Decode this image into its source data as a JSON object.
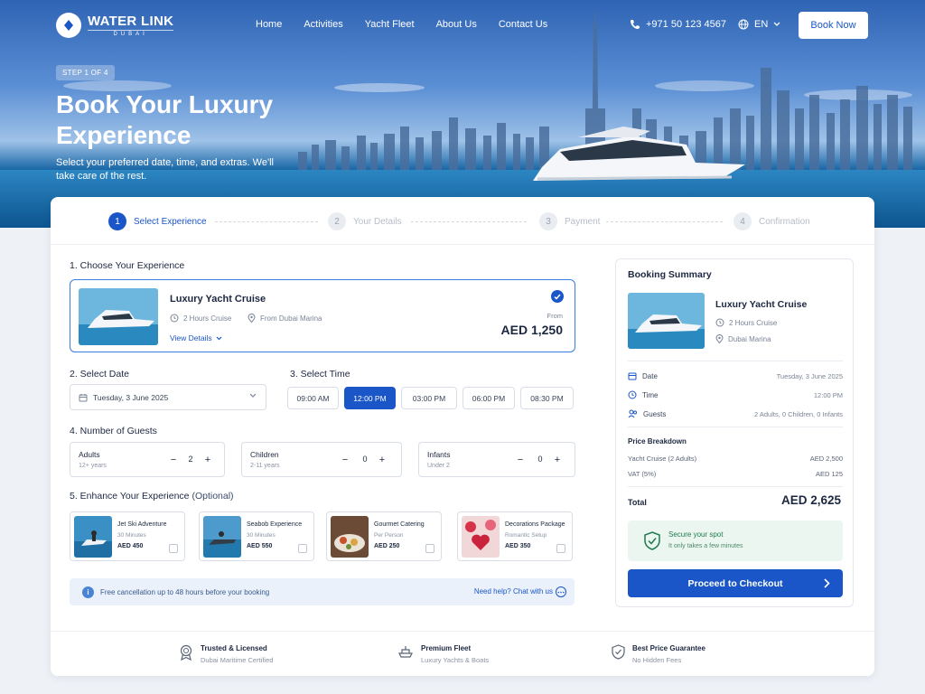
{
  "brand": {
    "name": "WATER LINK",
    "sub": "DUBAI"
  },
  "nav": {
    "links": [
      "Home",
      "Activities",
      "Yacht Fleet",
      "About Us",
      "Contact Us"
    ],
    "phone": "+971 50 123 4567",
    "lang": "EN",
    "book_now": "Book Now"
  },
  "hero": {
    "step": "STEP 1 OF 4",
    "title": "Book Your Luxury Experience",
    "subtitle": "Select your preferred date, time, and extras. We'll take care of the rest."
  },
  "stepper": [
    {
      "num": "1",
      "label": "Select Experience"
    },
    {
      "num": "2",
      "label": "Your Details"
    },
    {
      "num": "3",
      "label": "Payment"
    },
    {
      "num": "4",
      "label": "Confirmation"
    }
  ],
  "sections": {
    "choose": "1. Choose Your Experience",
    "date": "2. Select Date",
    "time": "3. Select Time",
    "guests": "4. Number of Guests",
    "enhance": "5. Enhance Your Experience",
    "enhance_opt": "(Optional)"
  },
  "experience": {
    "name": "Luxury Yacht Cruise",
    "duration": "2 Hours Cruise",
    "location": "From Dubai Marina",
    "view": "View Details",
    "from": "From",
    "price": "AED 1,250"
  },
  "date": {
    "value": "Tuesday, 3 June 2025"
  },
  "times": [
    "09:00 AM",
    "12:00 PM",
    "03:00 PM",
    "06:00 PM",
    "08:30 PM"
  ],
  "guests": [
    {
      "label": "Adults",
      "sub": "12+ years",
      "value": "2"
    },
    {
      "label": "Children",
      "sub": "2-11 years",
      "value": "0"
    },
    {
      "label": "Infants",
      "sub": "Under 2",
      "value": "0"
    }
  ],
  "extras": [
    {
      "name": "Jet Ski Adventure",
      "sub": "30 Minutes",
      "price": "AED 450"
    },
    {
      "name": "Seabob Experience",
      "sub": "30 Minutes",
      "price": "AED 550"
    },
    {
      "name": "Gourmet Catering",
      "sub": "Per Person",
      "price": "AED 250"
    },
    {
      "name": "Decorations Package",
      "sub": "Romantic Setup",
      "price": "AED 350"
    }
  ],
  "info": {
    "text": "Free cancellation up to 48 hours before your booking",
    "help": "Need help? Chat with us"
  },
  "summary": {
    "title": "Booking Summary",
    "name": "Luxury Yacht Cruise",
    "duration": "2 Hours Cruise",
    "location": "Dubai Marina",
    "date_label": "Date",
    "date": "Tuesday, 3 June 2025",
    "time_label": "Time",
    "time": "12:00 PM",
    "guests_label": "Guests",
    "guests": "2 Adults, 0 Children, 0 Infants",
    "breakdown": "Price Breakdown",
    "line1_label": "Yacht Cruise (2 Adults)",
    "line1": "AED 2,500",
    "line2_label": "VAT (5%)",
    "line2": "AED 125",
    "total_label": "Total",
    "total": "AED 2,625",
    "secure_title": "Secure your spot",
    "secure_sub": "It only takes a few minutes",
    "checkout": "Proceed to Checkout"
  },
  "trust": [
    {
      "title": "Trusted & Licensed",
      "sub": "Dubai Maritime Certified"
    },
    {
      "title": "Premium Fleet",
      "sub": "Luxury Yachts & Boats"
    },
    {
      "title": "Best Price Guarantee",
      "sub": "No Hidden Fees"
    }
  ],
  "colors": {
    "primary": "#1a56c8",
    "secure_bg": "#ecf6f1"
  }
}
